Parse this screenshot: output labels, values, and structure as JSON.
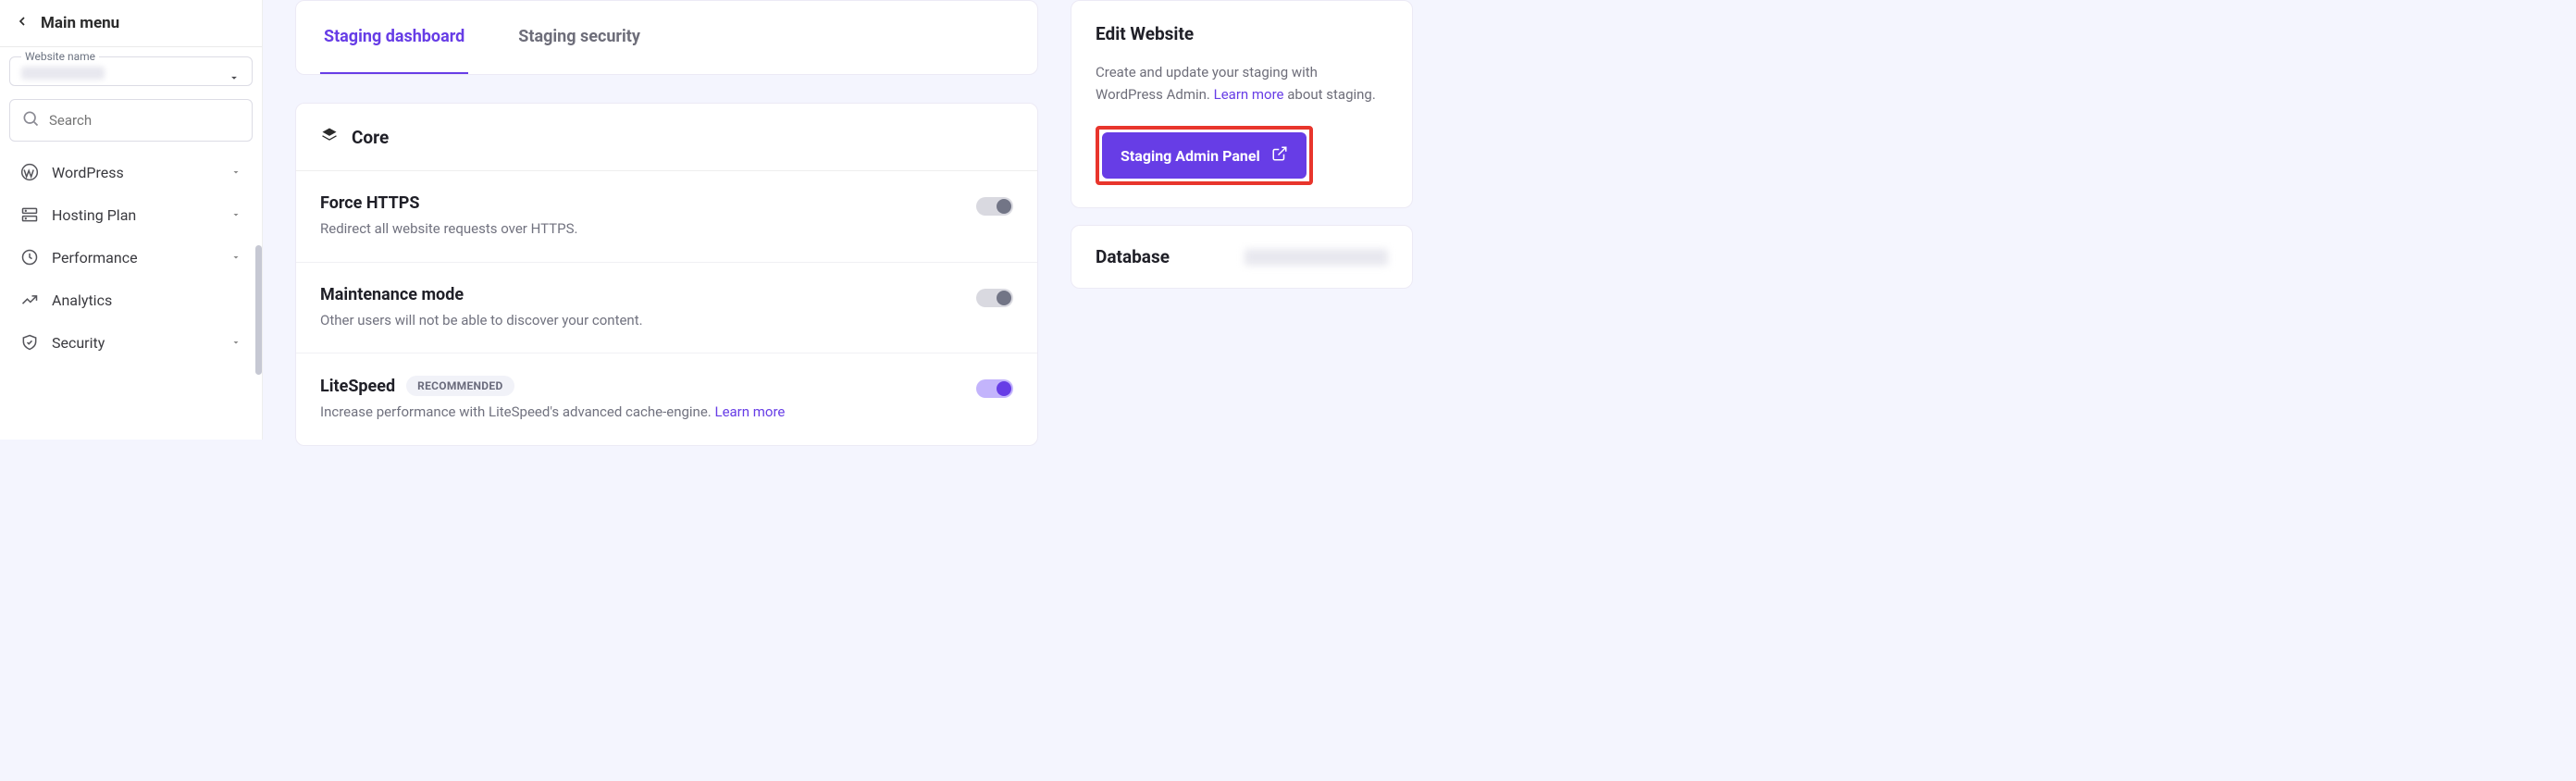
{
  "sidebar": {
    "main_menu": "Main menu",
    "website_field_label": "Website name",
    "search_placeholder": "Search",
    "items": [
      {
        "label": "WordPress",
        "icon": "wordpress",
        "expandable": true
      },
      {
        "label": "Hosting Plan",
        "icon": "servers",
        "expandable": true
      },
      {
        "label": "Performance",
        "icon": "clock",
        "expandable": true
      },
      {
        "label": "Analytics",
        "icon": "chart",
        "expandable": false
      },
      {
        "label": "Security",
        "icon": "shield",
        "expandable": true
      }
    ]
  },
  "tabs": {
    "active": "Staging dashboard",
    "inactive": "Staging security"
  },
  "core": {
    "title": "Core",
    "settings": [
      {
        "title": "Force HTTPS",
        "desc": "Redirect all website requests over HTTPS.",
        "toggle": "off",
        "recommended": false
      },
      {
        "title": "Maintenance mode",
        "desc": "Other users will not be able to discover your content.",
        "toggle": "off",
        "recommended": false
      },
      {
        "title": "LiteSpeed",
        "desc": "Increase performance with LiteSpeed's advanced cache-engine. ",
        "learn_more": "Learn more",
        "toggle": "on",
        "recommended": true,
        "recommended_label": "RECOMMENDED"
      }
    ]
  },
  "edit_website": {
    "title": "Edit Website",
    "desc_pre": "Create and update your staging with WordPress Admin. ",
    "learn_more": "Learn more",
    "desc_post": " about staging.",
    "button": "Staging Admin Panel"
  },
  "database": {
    "title": "Database"
  }
}
